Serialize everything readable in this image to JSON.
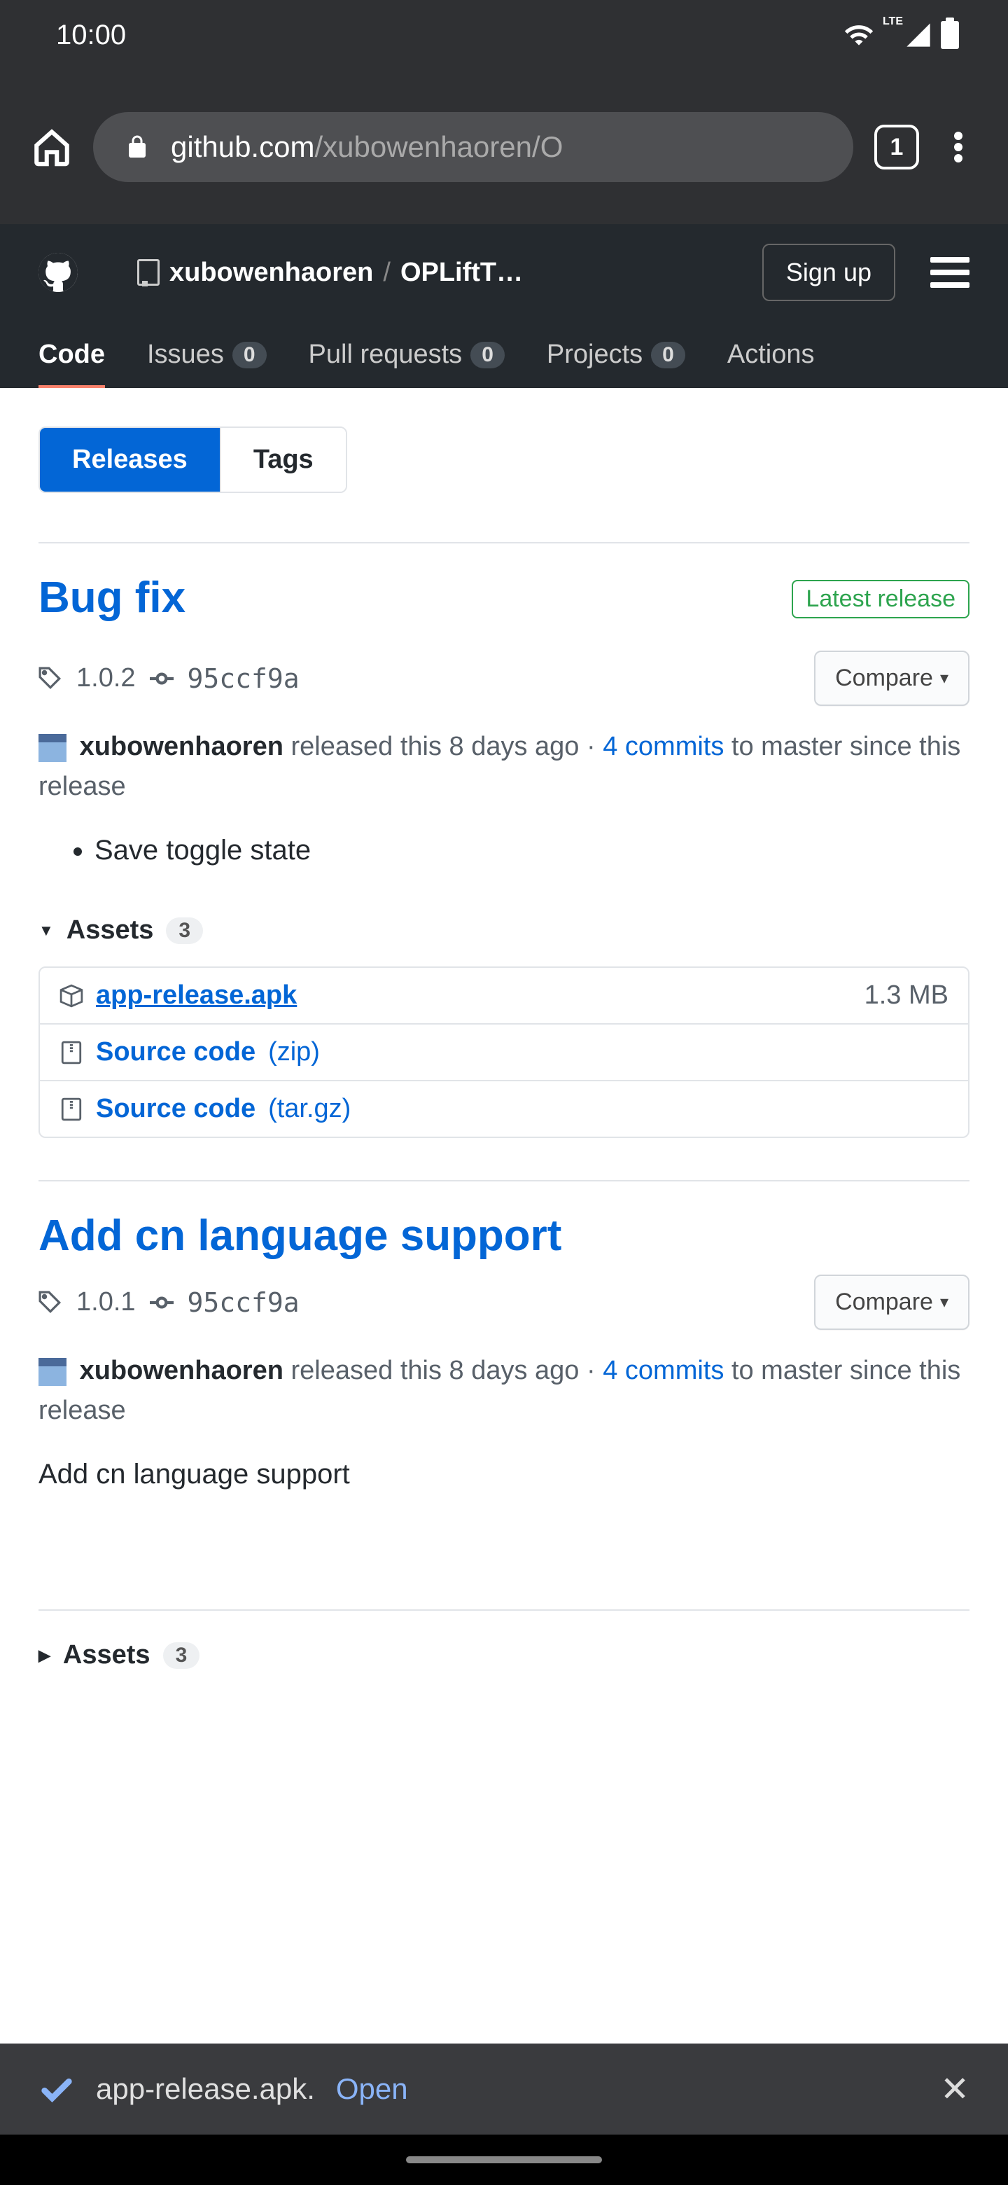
{
  "status": {
    "time": "10:00",
    "lte": "LTE"
  },
  "browser": {
    "url_domain": "github.com",
    "url_path": "/xubowenhaoren/O",
    "tab_count": "1"
  },
  "header": {
    "owner": "xubowenhaoren",
    "sep": "/",
    "repo": "OPLiftT…",
    "signup": "Sign up"
  },
  "nav_tabs": {
    "code": "Code",
    "issues": "Issues",
    "issues_count": "0",
    "pulls": "Pull requests",
    "pulls_count": "0",
    "projects": "Projects",
    "projects_count": "0",
    "actions": "Actions"
  },
  "subtabs": {
    "releases": "Releases",
    "tags": "Tags"
  },
  "releases": [
    {
      "title": "Bug fix",
      "latest": "Latest release",
      "tag": "1.0.2",
      "commit": "95ccf9a",
      "compare": "Compare",
      "by_user": "xubowenhaoren",
      "by_action": "released this 8 days ago",
      "by_sep": "·",
      "by_commits": "4 commits",
      "by_tail": "to master since this release",
      "body_item": "Save toggle state",
      "assets_label": "Assets",
      "assets_count": "3",
      "assets": [
        {
          "name": "app-release.apk",
          "ext": "",
          "size": "1.3 MB",
          "icon": "package"
        },
        {
          "name": "Source code",
          "ext": "(zip)",
          "size": "",
          "icon": "zip"
        },
        {
          "name": "Source code",
          "ext": "(tar.gz)",
          "size": "",
          "icon": "zip"
        }
      ]
    },
    {
      "title": "Add cn language support",
      "tag": "1.0.1",
      "commit": "95ccf9a",
      "compare": "Compare",
      "by_user": "xubowenhaoren",
      "by_action": "released this 8 days ago",
      "by_sep": "·",
      "by_commits": "4 commits",
      "by_tail": "to master since this release",
      "body_text": "Add cn language support",
      "assets_label": "Assets",
      "assets_count": "3"
    }
  ],
  "download": {
    "file": "app-release.apk.",
    "open": "Open"
  }
}
